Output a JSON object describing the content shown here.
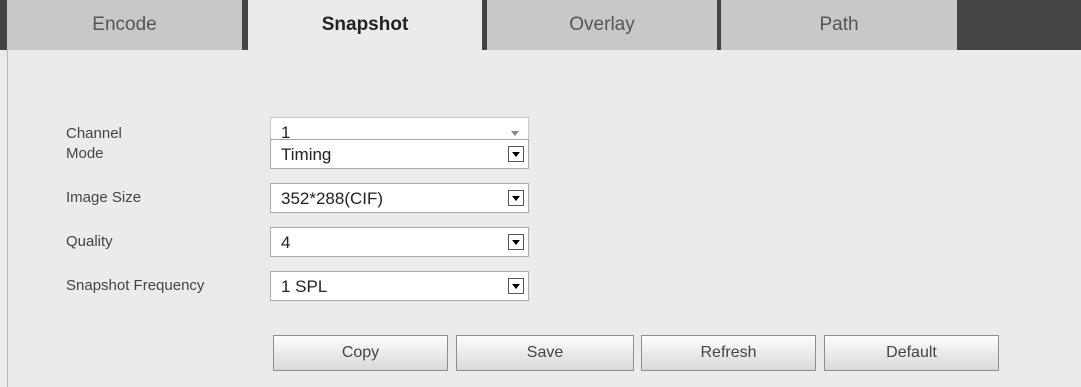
{
  "tabs": [
    {
      "label": "Encode",
      "active": false
    },
    {
      "label": "Snapshot",
      "active": true
    },
    {
      "label": "Overlay",
      "active": false
    },
    {
      "label": "Path",
      "active": false
    }
  ],
  "form": {
    "channel": {
      "label": "Channel",
      "value": "1",
      "disabled": true
    },
    "mode": {
      "label": "Mode",
      "value": "Timing"
    },
    "image_size": {
      "label": "Image Size",
      "value": "352*288(CIF)"
    },
    "quality": {
      "label": "Quality",
      "value": "4"
    },
    "frequency": {
      "label": "Snapshot Frequency",
      "value": "1 SPL"
    }
  },
  "buttons": {
    "copy": "Copy",
    "save": "Save",
    "refresh": "Refresh",
    "default": "Default"
  },
  "colors": {
    "tabbar_bg": "#444444",
    "tab_inactive_bg": "#c8c8c8",
    "panel_bg": "#ebebeb"
  },
  "icons": {
    "dropdown": "chevron-down-icon"
  }
}
